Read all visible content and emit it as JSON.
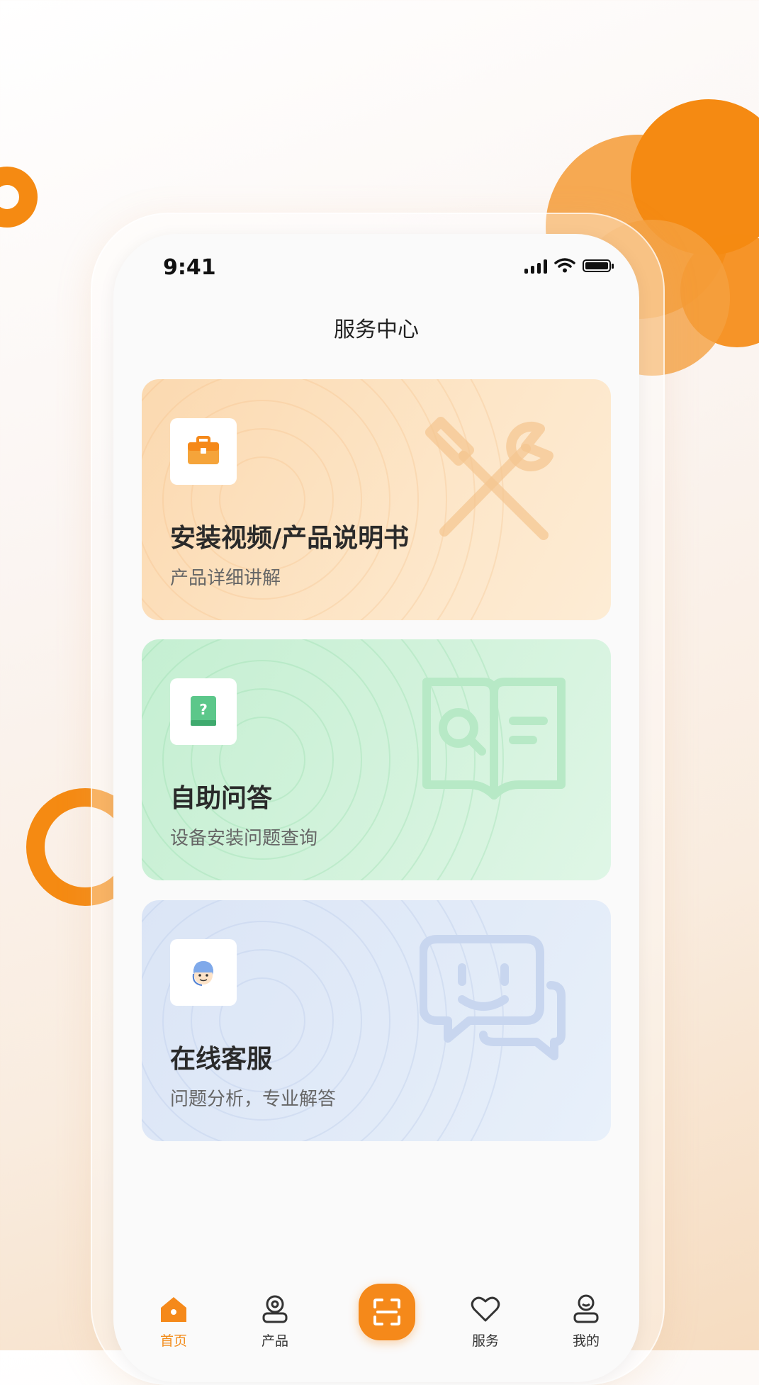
{
  "status_bar": {
    "time": "9:41"
  },
  "nav": {
    "title": "服务中心"
  },
  "cards": [
    {
      "title": "安装视频/产品说明书",
      "subtitle": "产品详细讲解",
      "icon": "toolbox-icon",
      "decoration": "tools-icon"
    },
    {
      "title": "自助问答",
      "subtitle": "设备安装问题查询",
      "icon": "question-book-icon",
      "decoration": "book-search-icon"
    },
    {
      "title": "在线客服",
      "subtitle": "问题分析，专业解答",
      "icon": "customer-service-icon",
      "decoration": "chat-bubbles-icon"
    }
  ],
  "tabbar": {
    "items": [
      {
        "label": "首页",
        "icon": "home-icon",
        "active": true
      },
      {
        "label": "产品",
        "icon": "camera-icon",
        "active": false
      },
      {
        "label": "",
        "icon": "scan-icon",
        "active": false
      },
      {
        "label": "服务",
        "icon": "heart-icon",
        "active": false
      },
      {
        "label": "我的",
        "icon": "user-icon",
        "active": false
      }
    ]
  },
  "colors": {
    "accent": "#f5891a",
    "card_orange": "#fbd9b0",
    "card_green": "#c5efd2",
    "card_blue": "#dbe5f6"
  }
}
